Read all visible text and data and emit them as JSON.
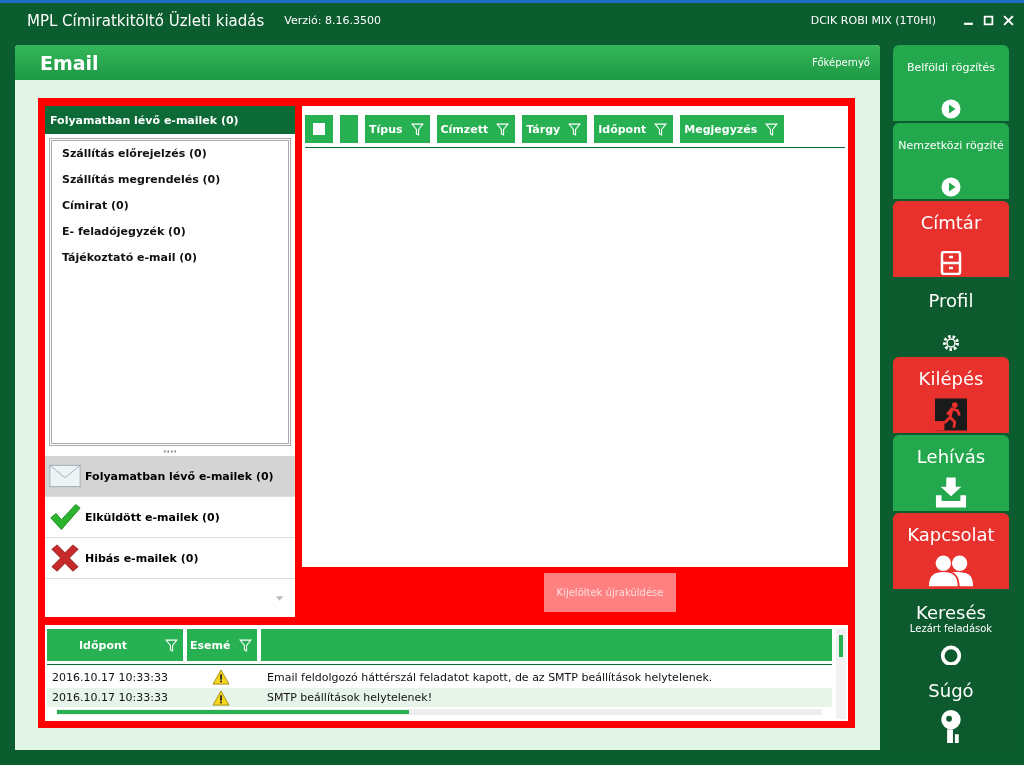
{
  "window": {
    "title": "MPL Címiratkitöltő Üzleti kiadás",
    "version": "Verzió: 8.16.3500",
    "user": "DCIK ROBI MIX  (1T0HI)"
  },
  "panel": {
    "title": "Email",
    "home_link": "Főképernyő"
  },
  "folder_header": "Folyamatban lévő e-mailek (0)",
  "categories": [
    {
      "label": "Szállítás előrejelzés (0)"
    },
    {
      "label": "Szállítás megrendelés (0)"
    },
    {
      "label": "Címirat (0)"
    },
    {
      "label": "E- feladójegyzék (0)"
    },
    {
      "label": "Tájékoztató e-mail (0)"
    }
  ],
  "mail_groups": [
    {
      "label": "Folyamatban lévő e-mailek (0)",
      "kind": "inbox",
      "selected": true
    },
    {
      "label": "Elküldött e-mailek (0)",
      "kind": "sent",
      "selected": false
    },
    {
      "label": "Hibás e-mailek (0)",
      "kind": "failed",
      "selected": false
    }
  ],
  "grid": {
    "select_all": {
      "checked": false
    },
    "columns": [
      "Típus",
      "Címzett",
      "Tárgy",
      "Időpont",
      "Megjegyzés"
    ]
  },
  "resend_button": {
    "label": "Kijelöltek újraküldése",
    "disabled": true
  },
  "log": {
    "columns": [
      "Időpont",
      "Esemé"
    ],
    "rows": [
      {
        "time": "2016.10.17 10:33:33",
        "message": "Email feldolgozó háttérszál feladatot kapott, de az SMTP beállítások helytelenek."
      },
      {
        "time": "2016.10.17 10:33:33",
        "message": "SMTP beállítások helytelenek!"
      }
    ]
  },
  "sidebar": [
    {
      "title": "Belföldi rögzítés",
      "kind": "compact",
      "color": "#23a84d"
    },
    {
      "title": "Nemzetközi rögzíté",
      "kind": "compact",
      "color": "#23a84d"
    },
    {
      "title": "Címtár",
      "kind": "large",
      "color": "#e8302c"
    },
    {
      "title": "Profil",
      "kind": "large",
      "color": "#0c5a2e"
    },
    {
      "title": "Kilépés",
      "kind": "large",
      "color": "#e8302c"
    },
    {
      "title": "Lehívás",
      "kind": "large",
      "color": "#23a84d"
    },
    {
      "title": "Kapcsolat",
      "kind": "large",
      "color": "#e8302c"
    },
    {
      "title": "Keresés",
      "subtitle": "Lezárt feladások",
      "kind": "large",
      "color": "#0c5a2e"
    },
    {
      "title": "Súgó",
      "kind": "large",
      "color": "#0c5a2e"
    }
  ]
}
